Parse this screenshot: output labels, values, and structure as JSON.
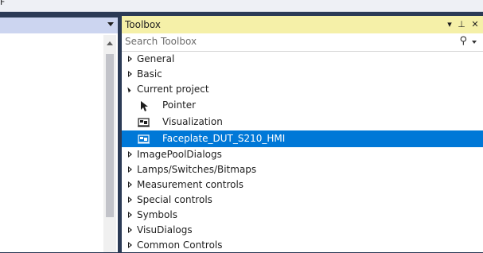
{
  "menubar": {
    "partial_label": "F"
  },
  "toolbox": {
    "title": "Toolbox",
    "search_placeholder": "Search Toolbox",
    "title_buttons": {
      "dropdown": "▾",
      "pin": "⊥",
      "close": "✕"
    },
    "groups_top": [
      "General",
      "Basic"
    ],
    "current_project": {
      "label": "Current project",
      "items": [
        {
          "label": "Pointer",
          "icon": "pointer-icon"
        },
        {
          "label": "Visualization",
          "icon": "visualization-icon"
        },
        {
          "label": "Faceplate_DUT_S210_HMI",
          "icon": "visualization-icon",
          "selected": true
        }
      ]
    },
    "groups_bottom": [
      "ImagePoolDialogs",
      "Lamps/Switches/Bitmaps",
      "Measurement controls",
      "Special controls",
      "Symbols",
      "VisuDialogs",
      "Common Controls"
    ]
  },
  "colors": {
    "title_bar": "#f5f0a8",
    "selection": "#0078d7",
    "background": "#2b3a55"
  }
}
